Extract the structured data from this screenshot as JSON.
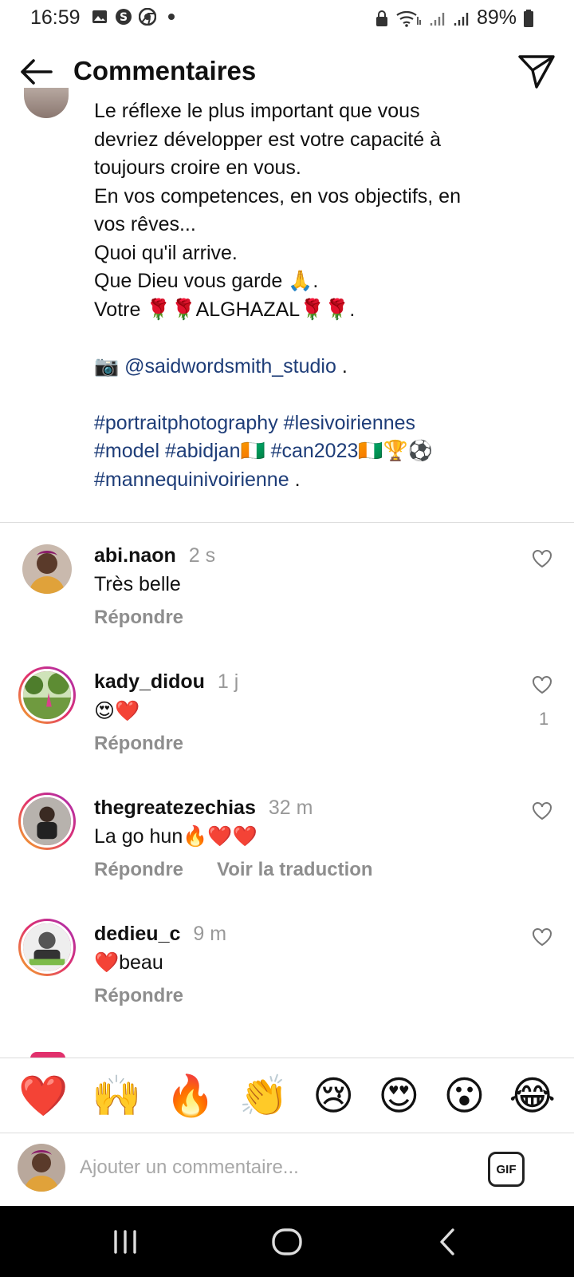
{
  "status_bar": {
    "time": "16:59",
    "battery": "89%",
    "left_icons": [
      "gallery-icon",
      "s-app-icon",
      "chrome-icon",
      "dot-icon"
    ],
    "right_icons": [
      "lock-icon",
      "wifi-icon",
      "signal-icon",
      "signal-icon",
      "battery-icon"
    ]
  },
  "header": {
    "title": "Commentaires"
  },
  "caption": {
    "lines": [
      "Le réflexe le plus important que vous",
      "devriez développer est votre capacité à",
      "toujours croire en vous.",
      "En vos competences, en vos objectifs, en",
      "vos rêves...",
      "Quoi qu'il arrive.",
      "Que Dieu vous garde 🙏.",
      "Votre 🌹🌹ALGHAZAL🌹🌹."
    ],
    "photo_credit_emoji": "📷",
    "photo_credit": "@saidwordsmith_studio",
    "photo_credit_suffix": " .",
    "hashtag_line1": "#portraitphotography #lesivoiriennes",
    "hashtag_line2_a": "#model #abidjan",
    "hashtag_line2_b": "🇨🇮 ",
    "hashtag_line2_c": "#can2023",
    "hashtag_line2_d": "🇨🇮🏆⚽",
    "hashtag_line3": "#mannequinivoirienne",
    "hashtag_line3_suffix": " ."
  },
  "comments": [
    {
      "username": "abi.naon",
      "time": "2 s",
      "text": "Très belle",
      "reply": "Répondre",
      "likes": ""
    },
    {
      "username": "kady_didou",
      "time": "1 j",
      "text": "😍❤️",
      "reply": "Répondre",
      "likes": "1"
    },
    {
      "username": "thegreatezechias",
      "time": "32 m",
      "text": "La go hun🔥❤️❤️",
      "reply": "Répondre",
      "translate": "Voir la traduction",
      "likes": ""
    },
    {
      "username": "dedieu_c",
      "time": "9 m",
      "text": "❤️beau",
      "reply": "Répondre",
      "likes": ""
    }
  ],
  "quick_emojis": [
    "❤️",
    "🙌",
    "🔥",
    "👏",
    "😢",
    "😍",
    "😮",
    "😂"
  ],
  "input": {
    "placeholder": "Ajouter un commentaire...",
    "gif_label": "GIF"
  },
  "colors": {
    "link": "#1e3d78",
    "muted": "#8e8e8e",
    "story_ring": [
      "#f5b024",
      "#e1306c",
      "#a72eb5"
    ]
  }
}
